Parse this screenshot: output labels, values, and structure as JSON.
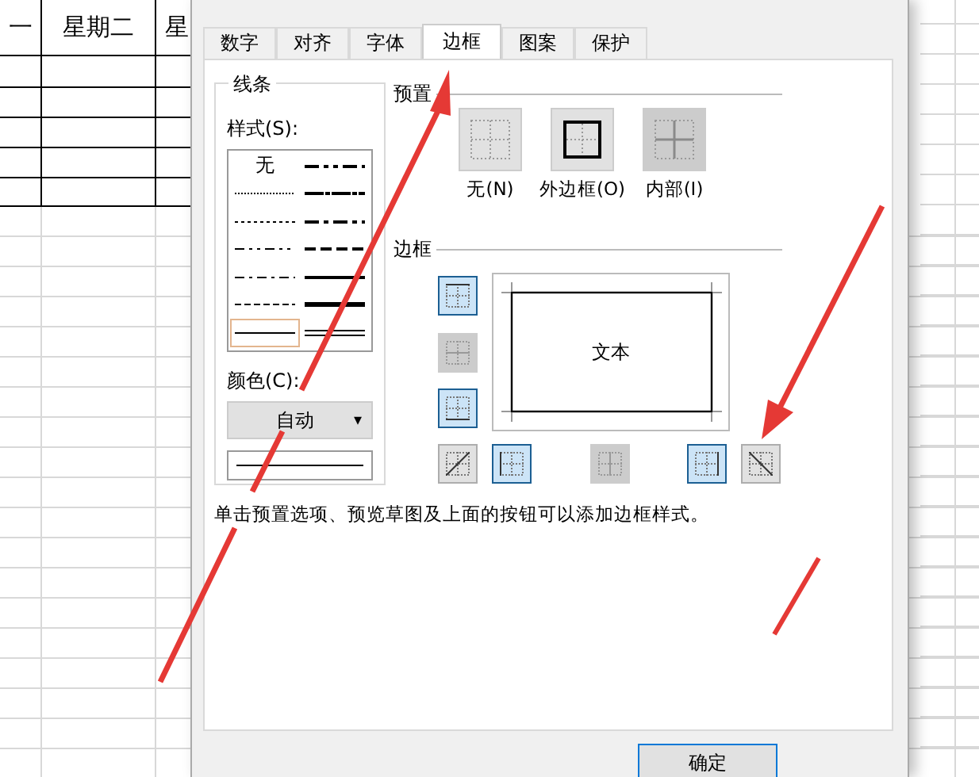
{
  "sheet": {
    "header_cells": [
      "一",
      "星期二",
      "星"
    ]
  },
  "dialog": {
    "tabs": [
      {
        "label": "数字",
        "selected": false
      },
      {
        "label": "对齐",
        "selected": false
      },
      {
        "label": "字体",
        "selected": false
      },
      {
        "label": "边框",
        "selected": true
      },
      {
        "label": "图案",
        "selected": false
      },
      {
        "label": "保护",
        "selected": false
      }
    ],
    "line_group": {
      "title": "线条",
      "style_label": "样式(S):",
      "styles": [
        {
          "kind": "none",
          "label": "无",
          "selected": false
        },
        {
          "kind": "medium-dash-dot-dot",
          "selected": false
        },
        {
          "kind": "hair",
          "selected": false
        },
        {
          "kind": "slanted-dash-dot",
          "selected": false
        },
        {
          "kind": "dotted",
          "selected": false
        },
        {
          "kind": "medium-dash-dot",
          "selected": false
        },
        {
          "kind": "dash-dot-dot",
          "selected": false
        },
        {
          "kind": "medium-dashed",
          "selected": false
        },
        {
          "kind": "dash-dot",
          "selected": false
        },
        {
          "kind": "medium",
          "selected": false
        },
        {
          "kind": "dashed",
          "selected": false
        },
        {
          "kind": "thick",
          "selected": false
        },
        {
          "kind": "thin",
          "selected": true
        },
        {
          "kind": "double",
          "selected": false
        }
      ],
      "color_label": "颜色(C):",
      "color_value": "自动",
      "dropdown_caret": "▾"
    },
    "preset": {
      "title": "预置",
      "items": [
        {
          "kind": "none",
          "label": "无(N)",
          "disabled": false
        },
        {
          "kind": "outline",
          "label": "外边框(O)",
          "disabled": false
        },
        {
          "kind": "inside",
          "label": "内部(I)",
          "disabled": true
        }
      ]
    },
    "border": {
      "title": "边框",
      "preview_text": "文本",
      "buttons": [
        {
          "kind": "top",
          "selected": true,
          "disabled": false
        },
        {
          "kind": "middle-h",
          "selected": false,
          "disabled": true
        },
        {
          "kind": "bottom",
          "selected": true,
          "disabled": false
        },
        {
          "kind": "diag-up",
          "selected": false,
          "disabled": false
        },
        {
          "kind": "left",
          "selected": true,
          "disabled": false
        },
        {
          "kind": "middle-v",
          "selected": false,
          "disabled": true
        },
        {
          "kind": "right",
          "selected": true,
          "disabled": false
        },
        {
          "kind": "diag-down",
          "selected": false,
          "disabled": false
        }
      ]
    },
    "hint": "单击预置选项、预览草图及上面的按钮可以添加边框样式。",
    "buttons": [
      "确定"
    ]
  }
}
